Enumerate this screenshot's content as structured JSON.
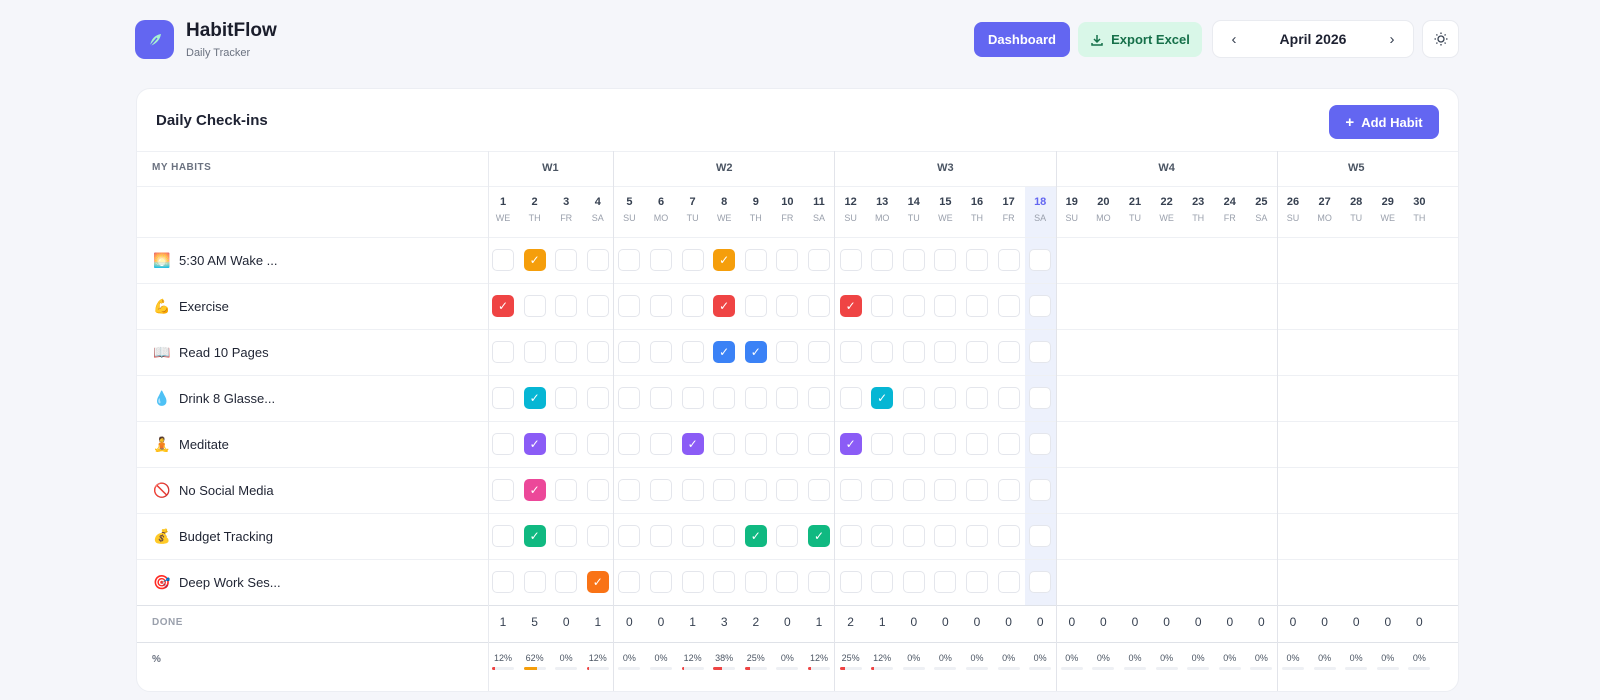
{
  "app": {
    "title": "HabitFlow",
    "subtitle": "Daily Tracker"
  },
  "header": {
    "dashboard_label": "Dashboard",
    "export_label": "Export Excel",
    "month_label": "April 2026"
  },
  "card": {
    "title": "Daily Check-ins",
    "add_label": "Add Habit",
    "habits_header": "MY HABITS",
    "done_label": "DONE",
    "pct_label": "%"
  },
  "weeks": [
    {
      "label": "W1",
      "start": 0,
      "end": 3
    },
    {
      "label": "W2",
      "start": 4,
      "end": 10
    },
    {
      "label": "W3",
      "start": 11,
      "end": 17
    },
    {
      "label": "W4",
      "start": 18,
      "end": 24
    },
    {
      "label": "W5",
      "start": 25,
      "end": 29
    }
  ],
  "days": [
    {
      "n": "1",
      "wd": "WE"
    },
    {
      "n": "2",
      "wd": "TH"
    },
    {
      "n": "3",
      "wd": "FR"
    },
    {
      "n": "4",
      "wd": "SA"
    },
    {
      "n": "5",
      "wd": "SU"
    },
    {
      "n": "6",
      "wd": "MO"
    },
    {
      "n": "7",
      "wd": "TU"
    },
    {
      "n": "8",
      "wd": "WE"
    },
    {
      "n": "9",
      "wd": "TH"
    },
    {
      "n": "10",
      "wd": "FR"
    },
    {
      "n": "11",
      "wd": "SA"
    },
    {
      "n": "12",
      "wd": "SU"
    },
    {
      "n": "13",
      "wd": "MO"
    },
    {
      "n": "14",
      "wd": "TU"
    },
    {
      "n": "15",
      "wd": "WE"
    },
    {
      "n": "16",
      "wd": "TH"
    },
    {
      "n": "17",
      "wd": "FR"
    },
    {
      "n": "18",
      "wd": "SA"
    },
    {
      "n": "19",
      "wd": "SU"
    },
    {
      "n": "20",
      "wd": "MO"
    },
    {
      "n": "21",
      "wd": "TU"
    },
    {
      "n": "22",
      "wd": "WE"
    },
    {
      "n": "23",
      "wd": "TH"
    },
    {
      "n": "24",
      "wd": "FR"
    },
    {
      "n": "25",
      "wd": "SA"
    },
    {
      "n": "26",
      "wd": "SU"
    },
    {
      "n": "27",
      "wd": "MO"
    },
    {
      "n": "28",
      "wd": "TU"
    },
    {
      "n": "29",
      "wd": "WE"
    },
    {
      "n": "30",
      "wd": "TH"
    }
  ],
  "today": "18",
  "check_mark": "✓",
  "habits": [
    {
      "icon": "🌅",
      "name": "5:30 AM Wake ...",
      "color": "#f59e0b",
      "checked": [
        "2",
        "8"
      ]
    },
    {
      "icon": "💪",
      "name": "Exercise",
      "color": "#ef4444",
      "checked": [
        "1",
        "8",
        "12"
      ]
    },
    {
      "icon": "📖",
      "name": "Read 10 Pages",
      "color": "#3b82f6",
      "checked": [
        "8",
        "9"
      ]
    },
    {
      "icon": "💧",
      "name": "Drink 8 Glasse...",
      "color": "#06b6d4",
      "checked": [
        "2",
        "13"
      ]
    },
    {
      "icon": "🧘",
      "name": "Meditate",
      "color": "#8b5cf6",
      "checked": [
        "2",
        "7",
        "12"
      ]
    },
    {
      "icon": "🚫",
      "name": "No Social Media",
      "color": "#ec4899",
      "checked": [
        "2"
      ]
    },
    {
      "icon": "💰",
      "name": "Budget Tracking",
      "color": "#10b981",
      "checked": [
        "2",
        "9",
        "11"
      ]
    },
    {
      "icon": "🎯",
      "name": "Deep Work Ses...",
      "color": "#f97316",
      "checked": [
        "4"
      ]
    }
  ],
  "done": [
    "1",
    "5",
    "0",
    "1",
    "0",
    "0",
    "1",
    "3",
    "2",
    "0",
    "1",
    "2",
    "1",
    "0",
    "0",
    "0",
    "0",
    "0",
    "0",
    "0",
    "0",
    "0",
    "0",
    "0",
    "0",
    "0",
    "0",
    "0",
    "0",
    "0"
  ],
  "pct": [
    "12%",
    "62%",
    "0%",
    "12%",
    "0%",
    "0%",
    "12%",
    "38%",
    "25%",
    "0%",
    "12%",
    "25%",
    "12%",
    "0%",
    "0%",
    "0%",
    "0%",
    "0%",
    "0%",
    "0%",
    "0%",
    "0%",
    "0%",
    "0%",
    "0%",
    "0%",
    "0%",
    "0%",
    "0%",
    "0%"
  ],
  "pct_values": [
    0.12,
    0.62,
    0,
    0.12,
    0,
    0,
    0.12,
    0.38,
    0.25,
    0,
    0.12,
    0.25,
    0.12,
    0,
    0,
    0,
    0,
    0,
    0,
    0,
    0,
    0,
    0,
    0,
    0,
    0,
    0,
    0,
    0,
    0
  ],
  "colors": {
    "accent": "#6366f1",
    "export_bg": "#d9f7e8",
    "export_text": "#16704a",
    "today_bg": "#edf1fc",
    "bar_low": "#ef4444",
    "bar_mid": "#f59e0b"
  },
  "icons": {
    "logo": "leaf-icon",
    "export": "download-icon",
    "prev": "chevron-left-icon",
    "next": "chevron-right-icon",
    "theme": "sun-icon",
    "add": "plus-icon"
  }
}
